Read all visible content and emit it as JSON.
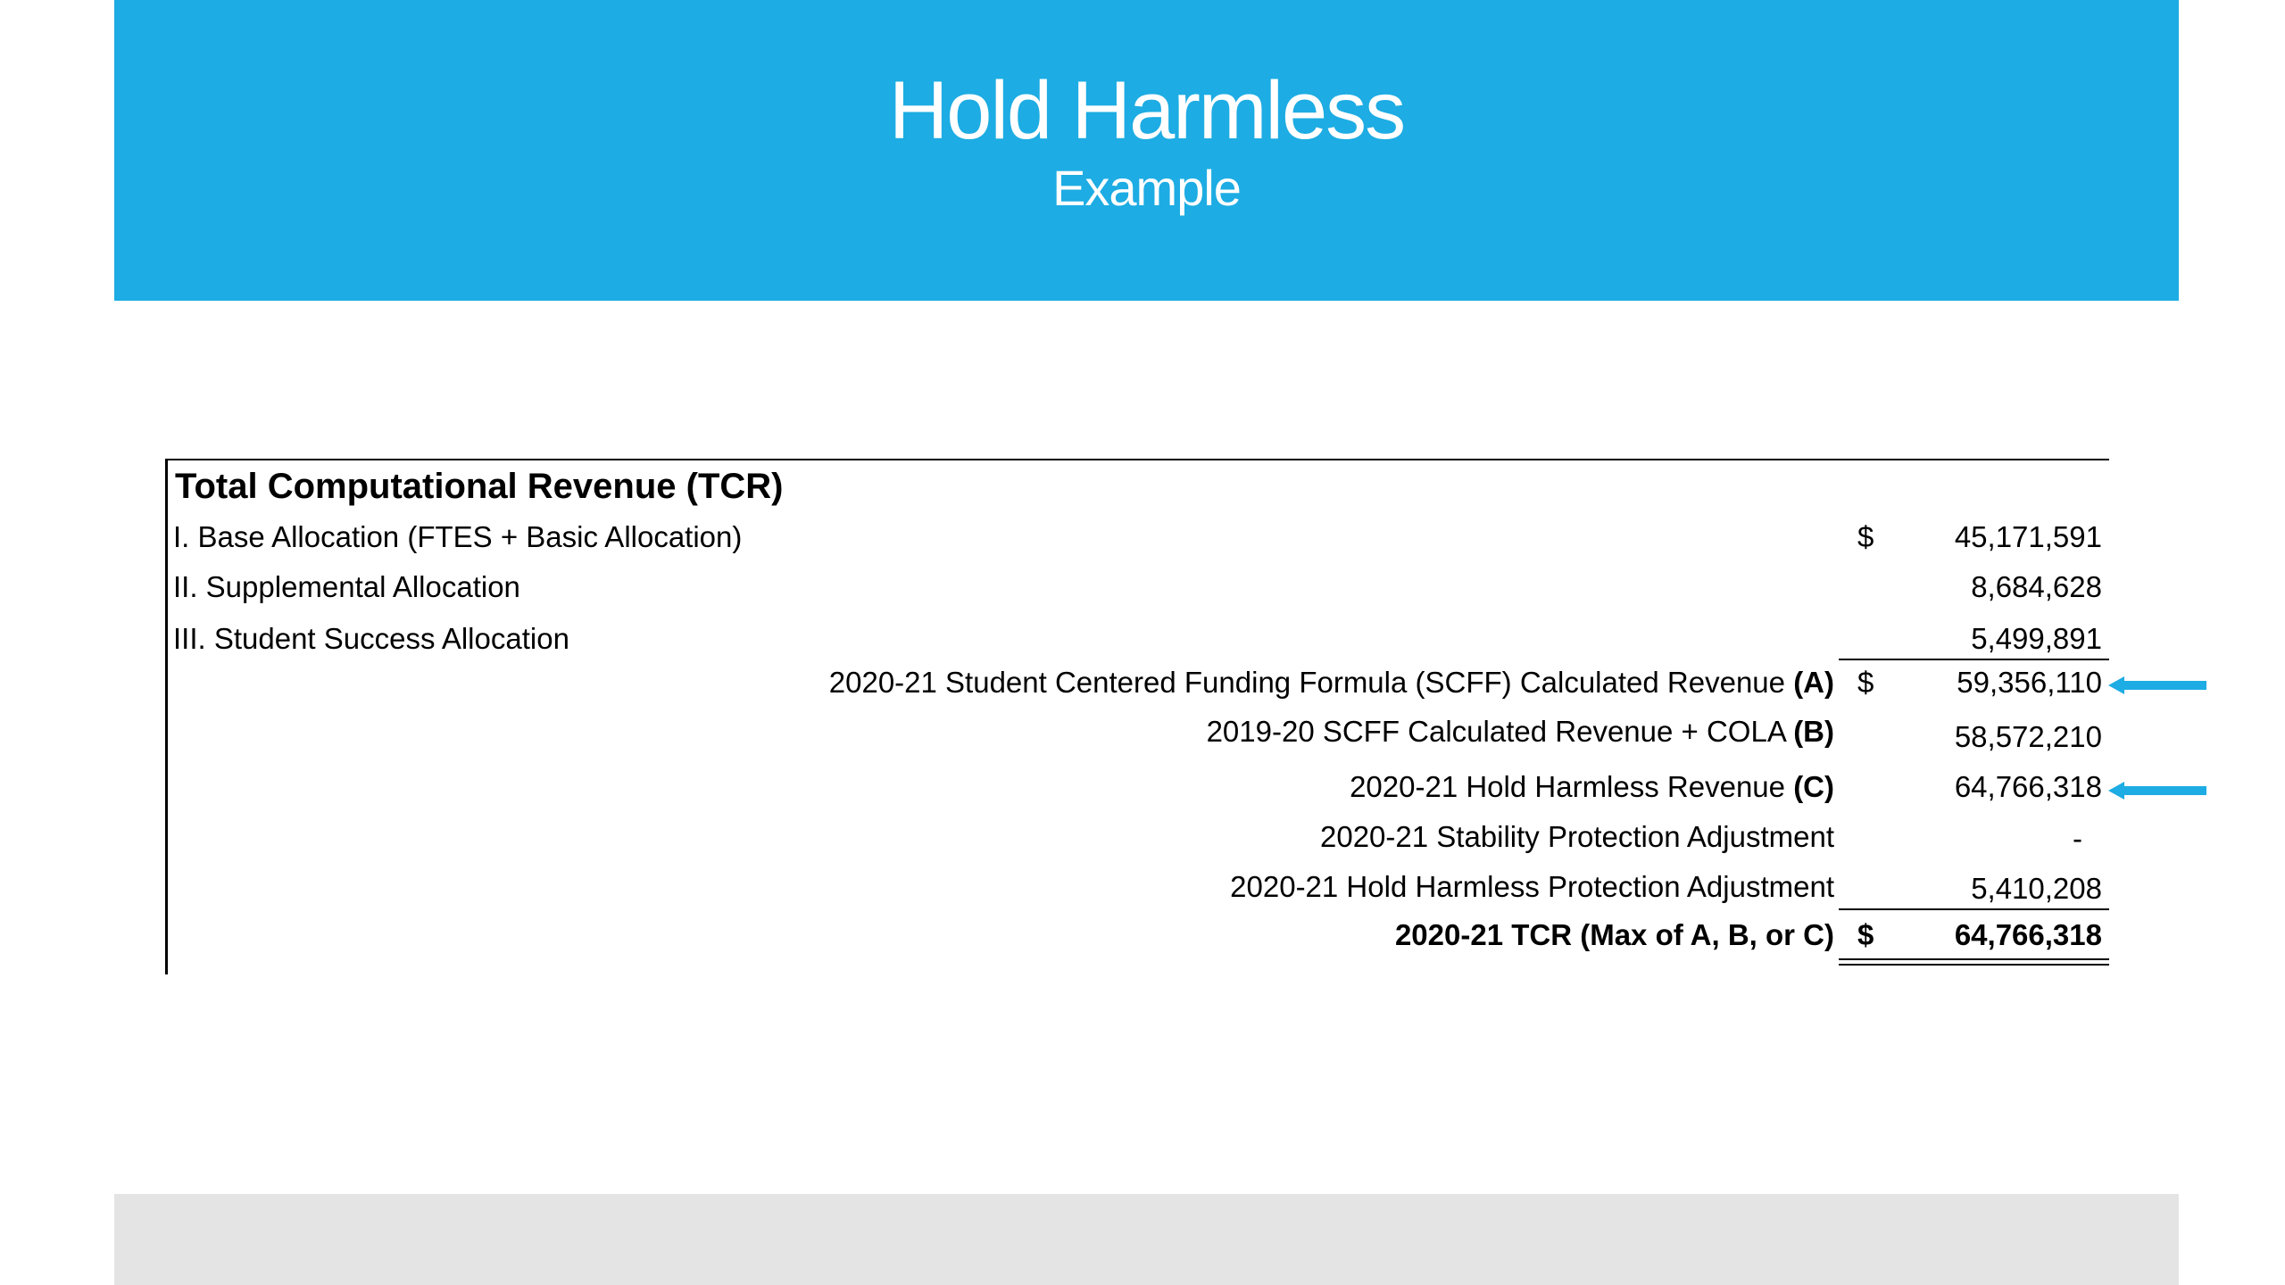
{
  "header": {
    "title": "Hold Harmless",
    "subtitle": "Example"
  },
  "table": {
    "heading": "Total Computational Revenue (TCR)",
    "currency_symbol": "$",
    "rows": [
      {
        "label": "I. Base Allocation (FTES + Basic Allocation)",
        "value": "45,171,591"
      },
      {
        "label": "II. Supplemental Allocation",
        "value": "8,684,628"
      },
      {
        "label": "III. Student Success Allocation",
        "value": "5,499,891"
      },
      {
        "label": "2020-21 Student Centered Funding Formula (SCFF) Calculated Revenue",
        "tag": "(A)",
        "value": "59,356,110"
      },
      {
        "label": "2019-20 SCFF Calculated Revenue + COLA",
        "tag": "(B)",
        "value": "58,572,210"
      },
      {
        "label": "2020-21 Hold Harmless Revenue",
        "tag": "(C)",
        "value": "64,766,318"
      },
      {
        "label": "2020-21 Stability Protection Adjustment",
        "value": "-"
      },
      {
        "label": "2020-21 Hold Harmless Protection Adjustment",
        "value": "5,410,208"
      },
      {
        "label": "2020-21 TCR (Max of A, B, or C)",
        "value": "64,766,318"
      }
    ]
  },
  "colors": {
    "header_bg": "#1DACE3",
    "footer_bg": "#E4E4E4",
    "arrow": "#1DACE3"
  },
  "icons": [
    "arrow-left-icon"
  ]
}
